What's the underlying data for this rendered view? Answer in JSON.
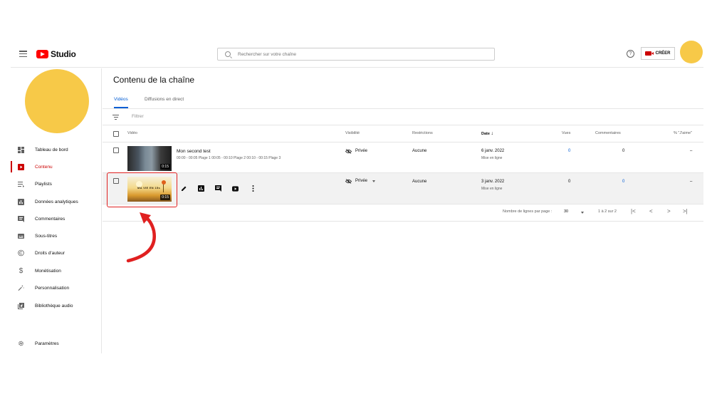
{
  "header": {
    "logo_text": "Studio",
    "search_placeholder": "Rechercher sur votre chaîne",
    "create_label": "CRÉER",
    "help_label": "?"
  },
  "sidebar": {
    "items": [
      {
        "label": "Tableau de bord",
        "icon": "dashboard-icon"
      },
      {
        "label": "Contenu",
        "icon": "content-icon",
        "active": true
      },
      {
        "label": "Playlists",
        "icon": "playlist-icon"
      },
      {
        "label": "Données analytiques",
        "icon": "analytics-icon"
      },
      {
        "label": "Commentaires",
        "icon": "comments-icon"
      },
      {
        "label": "Sous-titres",
        "icon": "subtitles-icon"
      },
      {
        "label": "Droits d'auteur",
        "icon": "copyright-icon"
      },
      {
        "label": "Monétisation",
        "icon": "dollar-icon"
      },
      {
        "label": "Personnalisation",
        "icon": "magic-wand-icon"
      },
      {
        "label": "Bibliothèque audio",
        "icon": "audio-library-icon"
      }
    ],
    "settings_label": "Paramètres"
  },
  "main": {
    "title": "Contenu de la chaîne",
    "tabs": [
      {
        "label": "Vidéos",
        "active": true
      },
      {
        "label": "Diffusions en direct"
      }
    ],
    "filter_label": "Filtrer",
    "columns": {
      "video": "Vidéo",
      "visibility": "Visibilité",
      "restrictions": "Restrictions",
      "date": "Date",
      "views": "Vues",
      "comments": "Commentaires",
      "likes": "% \"J'aime\""
    },
    "rows": [
      {
        "title": "Mon second test",
        "description": "00:00 - 00:05 Plage 1 00:05 - 00:10 Plage 2 00:10 - 00:15 Plage 3",
        "duration": "0:15",
        "visibility": "Privée",
        "restrictions": "Aucune",
        "date": "6 janv. 2022",
        "status": "Mise en ligne",
        "views": "0",
        "comments": "0",
        "likes": "–"
      },
      {
        "thumb_text": "MA VIE EN 15s",
        "duration": "0:15",
        "visibility": "Privée",
        "restrictions": "Aucune",
        "date": "3 janv. 2022",
        "status": "Mise en ligne",
        "views": "0",
        "comments": "0",
        "likes": "–"
      }
    ],
    "pagination": {
      "rows_per_page_label": "Nombre de lignes par page :",
      "rows_per_page": "30",
      "range": "1 à 2 sur 2"
    }
  },
  "colors": {
    "accent_red": "#cc0000",
    "link_blue": "#065fd4",
    "avatar_yellow": "#f7c948",
    "highlight_red": "#e02020"
  }
}
